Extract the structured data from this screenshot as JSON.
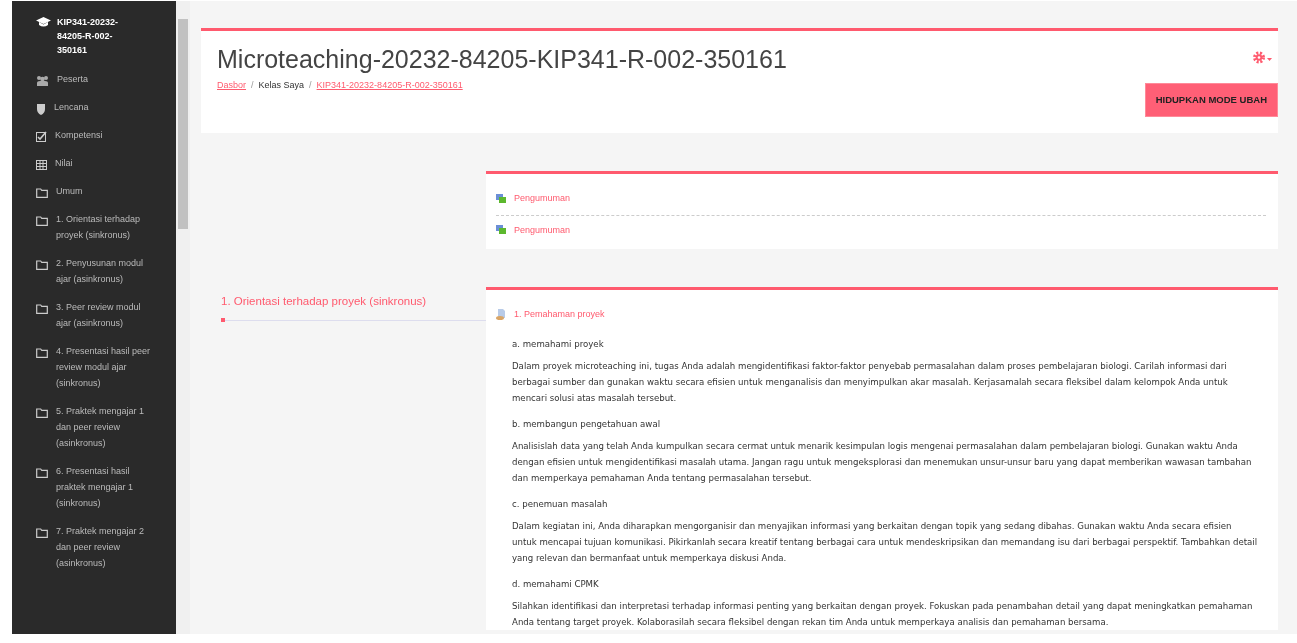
{
  "sidebar": {
    "course": "KIP341-20232-84205-R-002-350161",
    "items": [
      {
        "label": "Peserta",
        "kind": "people"
      },
      {
        "label": "Lencana",
        "kind": "badge"
      },
      {
        "label": "Kompetensi",
        "kind": "check"
      },
      {
        "label": "Nilai",
        "kind": "grid"
      },
      {
        "label": "Umum",
        "kind": "folder"
      },
      {
        "label": "1. Orientasi terhadap proyek (sinkronus)",
        "kind": "folder"
      },
      {
        "label": "2. Penyusunan modul ajar (asinkronus)",
        "kind": "folder"
      },
      {
        "label": "3. Peer review modul ajar (asinkronus)",
        "kind": "folder"
      },
      {
        "label": "4. Presentasi hasil peer review modul ajar (sinkronus)",
        "kind": "folder"
      },
      {
        "label": "5. Praktek mengajar 1 dan peer review (asinkronus)",
        "kind": "folder"
      },
      {
        "label": "6. Presentasi hasil praktek mengajar 1 (sinkronus)",
        "kind": "folder"
      },
      {
        "label": "7. Praktek mengajar 2 dan peer review (asinkronus)",
        "kind": "folder"
      }
    ]
  },
  "header": {
    "title": "Microteaching-20232-84205-KIP341-R-002-350161",
    "breadcrumb": [
      {
        "label": "Dasbor",
        "link": true
      },
      {
        "separator": "/",
        "label": "Kelas Saya",
        "link": false
      },
      {
        "separator": "/",
        "label": "KIP341-20232-84205-R-002-350161",
        "link": true
      }
    ],
    "edit_button": "HIDUPKAN MODE UBAH"
  },
  "general_section": {
    "activities": [
      {
        "label": "Pengumuman",
        "kind": "forum"
      },
      {
        "label": "Pengumuman",
        "kind": "forum"
      }
    ]
  },
  "section": {
    "title": "1. Orientasi terhadap proyek (sinkronus)",
    "activities": [
      {
        "label": "1. Pemahaman proyek",
        "kind": "page"
      }
    ],
    "content": [
      {
        "heading": "a. memahami proyek",
        "body": "Dalam proyek microteaching ini, tugas Anda adalah mengidentifikasi faktor-faktor penyebab permasalahan dalam proses pembelajaran biologi. Carilah informasi dari berbagai sumber dan gunakan waktu secara efisien untuk menganalisis dan menyimpulkan akar masalah. Kerjasamalah secara fleksibel dalam kelompok Anda untuk mencari solusi atas masalah tersebut."
      },
      {
        "heading": "b. membangun pengetahuan awal",
        "body": "Analisislah data yang telah Anda kumpulkan secara cermat untuk menarik kesimpulan logis mengenai permasalahan dalam pembelajaran biologi. Gunakan waktu Anda dengan efisien untuk mengidentifikasi masalah utama. Jangan ragu untuk mengeksplorasi dan menemukan unsur-unsur baru yang dapat memberikan wawasan tambahan dan memperkaya pemahaman Anda tentang permasalahan tersebut."
      },
      {
        "heading": "c. penemuan masalah",
        "body": "Dalam kegiatan ini, Anda diharapkan mengorganisir dan menyajikan informasi yang berkaitan dengan topik yang sedang dibahas. Gunakan waktu Anda secara efisien untuk mencapai tujuan komunikasi. Pikirkanlah secara kreatif tentang berbagai cara untuk mendeskripsikan dan memandang isu dari berbagai perspektif. Tambahkan detail yang relevan dan bermanfaat untuk memperkaya diskusi Anda."
      },
      {
        "heading": "d. memahami CPMK",
        "body": "Silahkan identifikasi dan interpretasi terhadap informasi penting yang berkaitan dengan proyek. Fokuskan pada penambahan detail yang dapat meningkatkan pemahaman Anda tentang target proyek. Kolaborasilah secara fleksibel dengan rekan tim Anda untuk memperkaya analisis dan pemahaman bersama."
      }
    ]
  }
}
